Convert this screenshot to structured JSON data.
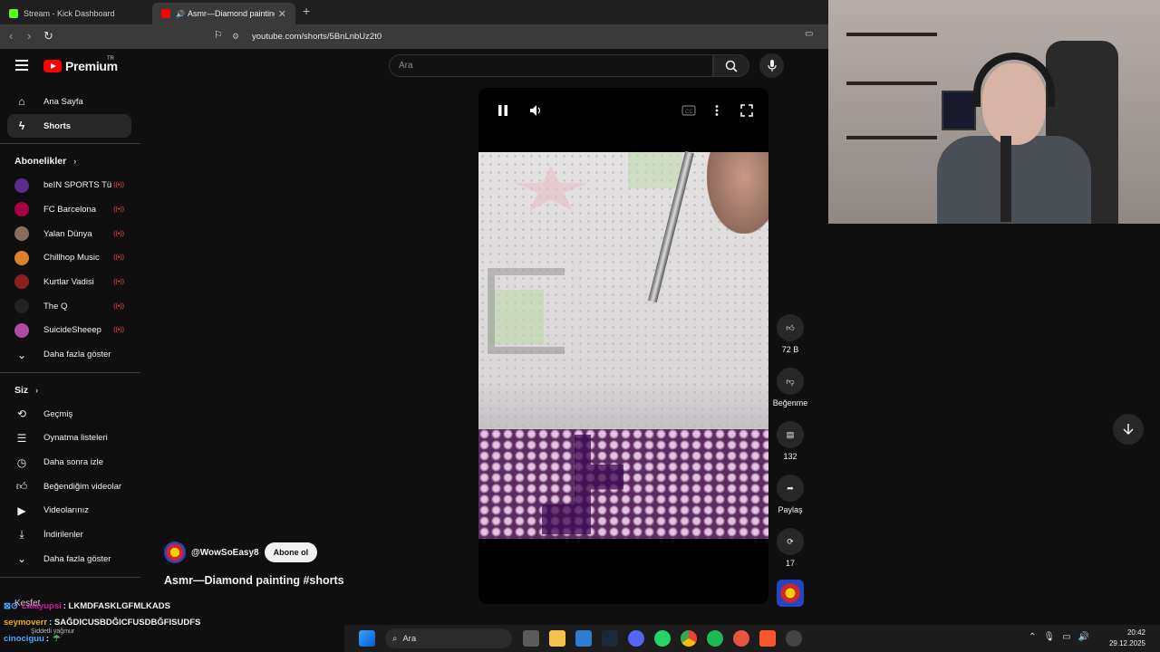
{
  "browser": {
    "tabs": [
      {
        "title": "Stream - Kick Dashboard",
        "active": false
      },
      {
        "title": "Asmr—Diamond painting #sh",
        "active": true
      }
    ],
    "url": "youtube.com/shorts/5BnLnbUz2t0"
  },
  "youtube": {
    "logo": "Premium",
    "logo_region": "TR",
    "search_placeholder": "Ara",
    "nav": [
      {
        "label": "Ana Sayfa",
        "icon": "home-icon"
      },
      {
        "label": "Shorts",
        "icon": "shorts-icon",
        "selected": true
      }
    ],
    "subs_header": "Abonelikler",
    "subscriptions": [
      {
        "name": "beIN SPORTS Tü...",
        "color": "#5b2d8e",
        "live": true
      },
      {
        "name": "FC Barcelona",
        "color": "#a50044",
        "live": true
      },
      {
        "name": "Yalan Dünya",
        "color": "#8a6d5a",
        "live": true
      },
      {
        "name": "Chillhop Music",
        "color": "#d9822b",
        "live": true
      },
      {
        "name": "Kurtlar Vadisi",
        "color": "#8b1e1e",
        "live": true
      },
      {
        "name": "The Q",
        "color": "#222222",
        "live": true
      },
      {
        "name": "SuicideSheeep",
        "color": "#b04aa0",
        "live": true
      }
    ],
    "subs_more": "Daha fazla göster",
    "you_header": "Siz",
    "you_items": [
      {
        "label": "Geçmiş",
        "icon": "history-icon"
      },
      {
        "label": "Oynatma listeleri",
        "icon": "playlist-icon"
      },
      {
        "label": "Daha sonra izle",
        "icon": "clock-icon"
      },
      {
        "label": "Beğendiğim videolar",
        "icon": "thumbs-up-icon"
      },
      {
        "label": "Videolarınız",
        "icon": "video-icon"
      },
      {
        "label": "İndirilenler",
        "icon": "download-icon"
      }
    ],
    "you_more": "Daha fazla göster",
    "explore": "Keşfet",
    "short": {
      "channel": "@WowSoEasy8",
      "subscribe": "Abone ol",
      "title": "Asmr—Diamond painting #shorts",
      "likes": "72 B",
      "dislike": "Beğenme",
      "comments": "132",
      "share": "Paylaş",
      "remix": "17"
    }
  },
  "chat": [
    {
      "user": "Lalayupsi",
      "message": ": LKMDFASKLGFMLKADS",
      "color": "#c81fa0"
    },
    {
      "user": "seymoverr",
      "message": ": SAĞDICUSBDĞICFUSDBĞFISUDFS",
      "color": "#e8b200"
    },
    {
      "user": "cinociguu",
      "message": ":",
      "color": "#4ea8ff"
    }
  ],
  "chat_caption": "Şiddetli yağmur",
  "taskbar": {
    "search": "Ara",
    "time": "20:42",
    "date": "29.12.2025"
  }
}
